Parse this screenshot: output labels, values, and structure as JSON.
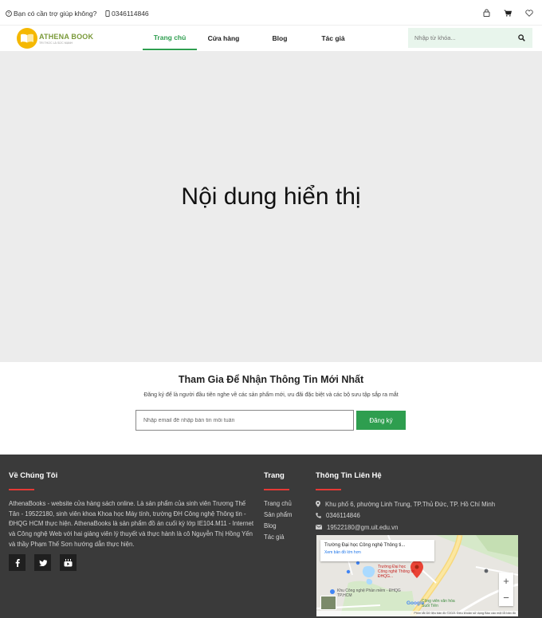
{
  "topbar": {
    "help_text": "Bạn có cần trợ giúp không?",
    "phone": "0346114846",
    "icons": [
      "user-icon",
      "cart-icon",
      "heart-icon"
    ]
  },
  "header": {
    "logo_brand": "ATHENA BOOK",
    "logo_tagline": "TRI THỨC LÀ SỨC MẠNH",
    "nav": [
      {
        "label": "Trang chủ",
        "active": true
      },
      {
        "label": "Cửa hàng",
        "active": false
      },
      {
        "label": "Blog",
        "active": false
      },
      {
        "label": "Tác giả",
        "active": false
      }
    ],
    "search_placeholder": "Nhập từ khóa..."
  },
  "main": {
    "placeholder_text": "Nội dung hiển thị"
  },
  "newsletter": {
    "title": "Tham Gia Để Nhận Thông Tin Mới Nhất",
    "subtitle": "Đăng ký để là người đầu tiên nghe về các sản phẩm mới, ưu đãi đặc biệt và các bộ sưu tập sắp ra mắt",
    "email_placeholder": "Nhập email để nhập bản tin mỗi tuần",
    "submit_label": "Đăng ký"
  },
  "footer": {
    "about": {
      "title": "Về Chúng Tôi",
      "text": "AthenaBooks - website cửa hàng sách online. Là sản phẩm của sinh viên Trương Thế Tân - 19522180, sinh viên khoa Khoa học Máy tính, trường ĐH Công nghệ Thông tin - ĐHQG HCM thực hiện. AthenaBooks là sản phẩm đồ án cuối kỳ lớp IE104.M11 - Internet và Công nghệ Web với hai giảng viên lý thuyết và thực hành là cô Nguyễn Thị Hồng Yến và thầy Phạm Thế Sơn hướng dẫn thực hiện.",
      "socials": [
        "facebook-icon",
        "twitter-icon",
        "youtube-icon"
      ]
    },
    "pages": {
      "title": "Trang",
      "links": [
        "Trang chủ",
        "Sản phẩm",
        "Blog",
        "Tác giả"
      ]
    },
    "contact": {
      "title": "Thông Tin Liên Hệ",
      "address": "Khu phố 6, phường Linh Trung, TP.Thủ Đức, TP. Hồ Chí Minh",
      "phone": "0346114846",
      "email": "19522180@gm.uit.edu.vn"
    },
    "map": {
      "place_title": "Trường Đại học Công nghệ Thông ti...",
      "larger_map_link": "Xem bản đồ lớn hơn",
      "marker_label": "Trường Đại học Công nghệ Thông tin ĐHQG...",
      "poi_label": "Khu Công nghệ Phần mềm - ĐHQG TP.HCM",
      "park_label": "Công viên văn hóa Suối Tiên",
      "zoom_in": "+",
      "zoom_out": "−",
      "attribution": "Phím tắt   Dữ liệu bản đồ ©2021   Điều khoản sử dụng   Báo cáo một lỗi bản đồ",
      "google": "Google"
    }
  }
}
